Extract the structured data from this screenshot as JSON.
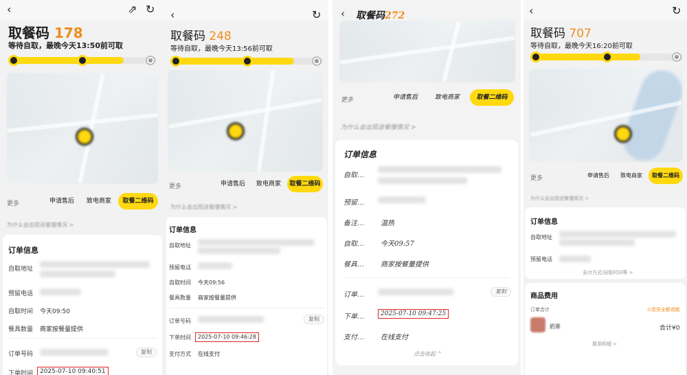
{
  "panel1": {
    "title_label": "取餐码",
    "code": "178",
    "status": "等待自取，最晚今天13:50前可取",
    "progress": 0.78,
    "more_label": "更多",
    "actions": [
      "申请售后",
      "致电商家",
      "取餐二维码"
    ],
    "tip": "为什么会出现送餐慢情况 >",
    "order_title": "订单信息",
    "rows": [
      {
        "label": "自取地址",
        "value": ""
      },
      {
        "label": "预留电话",
        "value": ""
      },
      {
        "label": "自取时间",
        "value": "今天09:50"
      },
      {
        "label": "餐具数量",
        "value": "商家按餐量提供"
      },
      {
        "label": "订单号码",
        "value": ""
      },
      {
        "label": "下单时间",
        "value": "2025-07-10 09:40:51"
      }
    ],
    "copy_label": "复制"
  },
  "panel2": {
    "title_label": "取餐码",
    "code": "248",
    "status": "等待自取，最晚今天13:56前可取",
    "progress": 0.81,
    "more_label": "更多",
    "actions": [
      "申请售后",
      "致电商家",
      "取餐二维码"
    ],
    "tip": "为什么会出现送餐慢情况 >",
    "order_title": "订单信息",
    "rows": [
      {
        "label": "自取地址",
        "value": ""
      },
      {
        "label": "预留电话",
        "value": ""
      },
      {
        "label": "自取时间",
        "value": "今天09:56"
      },
      {
        "label": "餐具数量",
        "value": "商家按餐量提供"
      },
      {
        "label": "订单号码",
        "value": ""
      },
      {
        "label": "下单时间",
        "value": "2025-07-10 09:46:28"
      },
      {
        "label": "支付方式",
        "value": "在线支付"
      }
    ],
    "copy_label": "复制"
  },
  "panel3": {
    "title_label": "取餐码",
    "code": "272",
    "more_label": "更多",
    "actions": [
      "申请售后",
      "致电商家",
      "取餐二维码"
    ],
    "tip": "为什么会出现送餐慢情况 >",
    "order_title": "订单信息",
    "rows": [
      {
        "label": "自取…",
        "value": ""
      },
      {
        "label": "预留…",
        "value": ""
      },
      {
        "label": "备注…",
        "value": "温热"
      },
      {
        "label": "自取…",
        "value": "今天09:57"
      },
      {
        "label": "餐具…",
        "value": "商家按餐量提供"
      },
      {
        "label": "订单…",
        "value": ""
      },
      {
        "label": "下单…",
        "value": "2025-07-10 09:47:25"
      },
      {
        "label": "支付…",
        "value": "在线支付"
      }
    ],
    "copy_label": "复制",
    "collapse_label": "点击收起 ^"
  },
  "panel4": {
    "title_label": "取餐码",
    "code": "707",
    "status": "等待自取，最晚今天16:20前可取",
    "progress": 0.72,
    "more_label": "更多",
    "actions": [
      "申请售后",
      "致电商家",
      "取餐二维码"
    ],
    "tip": "为什么会出现送餐慢情况 >",
    "order_title": "订单信息",
    "rows": [
      {
        "label": "自取地址",
        "value": ""
      },
      {
        "label": "预留电话",
        "value": ""
      }
    ],
    "support_link": "支付方式/自取时间等 >",
    "fee_title": "商品费用",
    "fee_sub_label": "订单合计",
    "fee_badge": "⊙退货全额退款",
    "item_name": "奶茶",
    "item_total": "合计¥0",
    "fee_detail": "费用明细 >"
  },
  "colors": {
    "accent": "#ffd90f",
    "code": "#f08c1a",
    "highlight": "#e02020"
  }
}
